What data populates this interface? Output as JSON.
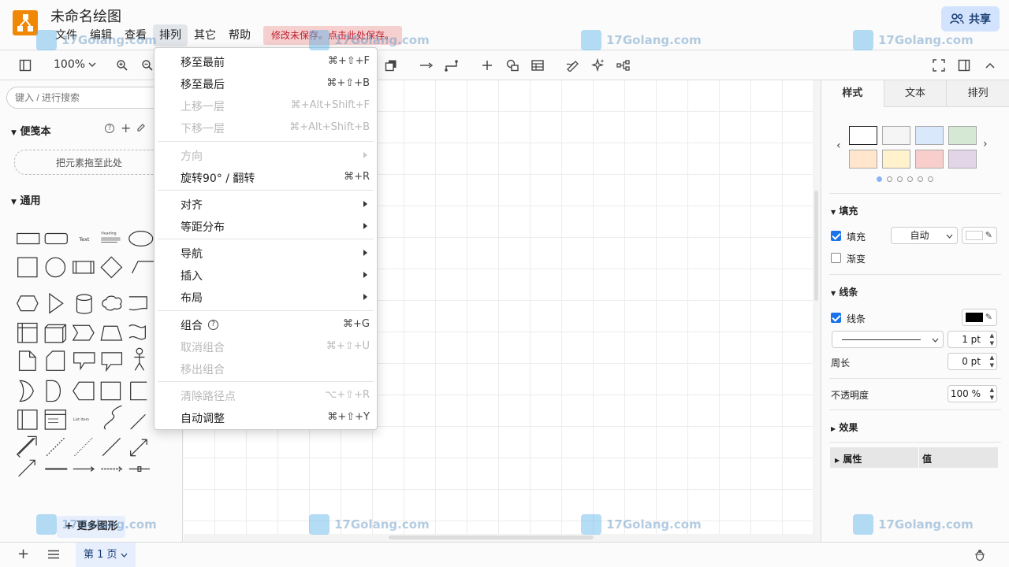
{
  "header": {
    "title": "未命名绘图",
    "menus": [
      "文件",
      "编辑",
      "查看",
      "排列",
      "其它",
      "帮助"
    ],
    "unsaved_notice": "修改未保存。点击此处保存。",
    "share_label": "共享"
  },
  "toolbar": {
    "zoom": "100%"
  },
  "sidebar": {
    "search_placeholder": "键入 / 进行搜索",
    "scratchpad_title": "便笺本",
    "scratchpad_drop": "把元素拖至此处",
    "general_title": "通用",
    "shape_text_label": "Text",
    "shape_heading_label": "Heading",
    "shape_list_label": "List Item",
    "more_shapes": "更多图形"
  },
  "arrange_menu": {
    "items": [
      {
        "label": "移至最前",
        "shortcut": "⌘+⇧+F"
      },
      {
        "label": "移至最后",
        "shortcut": "⌘+⇧+B"
      },
      {
        "label": "上移一层",
        "shortcut": "⌘+Alt+Shift+F"
      },
      {
        "label": "下移一层",
        "shortcut": "⌘+Alt+Shift+B"
      },
      {
        "label": "方向",
        "shortcut": ""
      },
      {
        "label": "旋转90° / 翻转",
        "shortcut": "⌘+R"
      },
      {
        "label": "对齐",
        "shortcut": ""
      },
      {
        "label": "等距分布",
        "shortcut": ""
      },
      {
        "label": "导航",
        "shortcut": ""
      },
      {
        "label": "插入",
        "shortcut": ""
      },
      {
        "label": "布局",
        "shortcut": ""
      },
      {
        "label": "组合",
        "shortcut": "⌘+G"
      },
      {
        "label": "取消组合",
        "shortcut": "⌘+⇧+U"
      },
      {
        "label": "移出组合",
        "shortcut": ""
      },
      {
        "label": "清除路径点",
        "shortcut": "⌥+⇧+R"
      },
      {
        "label": "自动调整",
        "shortcut": "⌘+⇧+Y"
      }
    ]
  },
  "format_panel": {
    "tabs": [
      "样式",
      "文本",
      "排列"
    ],
    "swatch_colors": [
      "#ffffff",
      "#f5f5f5",
      "#dae8fc",
      "#d5e8d4",
      "#ffe6cc",
      "#fff2cc",
      "#f8cecc",
      "#e1d5e7"
    ],
    "fill_section": "填充",
    "fill_label": "填充",
    "fill_value": "自动",
    "gradient_label": "渐变",
    "line_section": "线条",
    "line_label": "线条",
    "line_width": "1 pt",
    "perimeter_label": "周长",
    "perimeter_value": "0 pt",
    "opacity_label": "不透明度",
    "opacity_value": "100 %",
    "effects_label": "效果",
    "property_header": "属性",
    "value_header": "值"
  },
  "bottombar": {
    "page_tab": "第 1 页"
  },
  "watermark": {
    "text": "17Golang.com"
  }
}
